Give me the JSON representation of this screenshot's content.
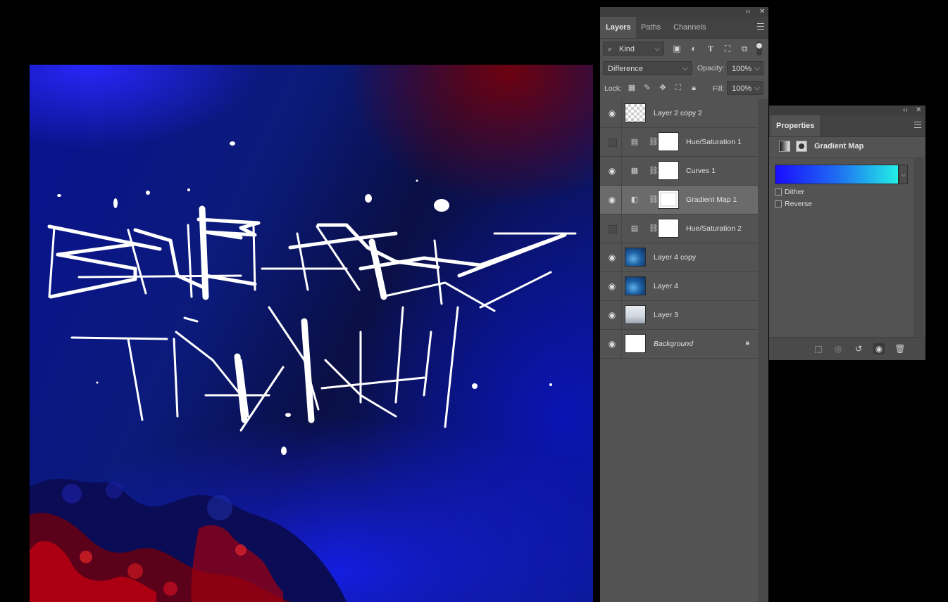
{
  "layers_panel": {
    "tabs": [
      "Layers",
      "Paths",
      "Channels"
    ],
    "filter_kind": "Kind",
    "blend_mode": "Difference",
    "opacity_label": "Opacity:",
    "opacity_value": "100%",
    "lock_label": "Lock:",
    "fill_label": "Fill:",
    "fill_value": "100%",
    "layers": [
      {
        "name": "Layer 2 copy 2",
        "visible": true,
        "thumb": "checker",
        "adjustment": null,
        "selected": false,
        "italic": false,
        "locked": false
      },
      {
        "name": "Hue/Saturation 1",
        "visible": false,
        "thumb": "mask",
        "adjustment": "hue-saturation-icon",
        "selected": false,
        "italic": false,
        "locked": false
      },
      {
        "name": "Curves 1",
        "visible": true,
        "thumb": "mask",
        "adjustment": "curves-icon",
        "selected": false,
        "italic": false,
        "locked": false
      },
      {
        "name": "Gradient Map 1",
        "visible": true,
        "thumb": "mask",
        "adjustment": "gradient-map-icon",
        "selected": true,
        "italic": false,
        "locked": false
      },
      {
        "name": "Hue/Saturation 2",
        "visible": false,
        "thumb": "mask",
        "adjustment": "hue-saturation-icon",
        "selected": false,
        "italic": false,
        "locked": false
      },
      {
        "name": "Layer 4 copy",
        "visible": true,
        "thumb": "water",
        "adjustment": null,
        "selected": false,
        "italic": false,
        "locked": false
      },
      {
        "name": "Layer 4",
        "visible": true,
        "thumb": "water",
        "adjustment": null,
        "selected": false,
        "italic": false,
        "locked": false
      },
      {
        "name": "Layer 3",
        "visible": true,
        "thumb": "snow",
        "adjustment": null,
        "selected": false,
        "italic": false,
        "locked": false
      },
      {
        "name": "Background",
        "visible": true,
        "thumb": "white",
        "adjustment": null,
        "selected": false,
        "italic": true,
        "locked": true
      }
    ]
  },
  "properties_panel": {
    "tab": "Properties",
    "title": "Gradient Map",
    "gradient_colors": [
      "#1a0cff",
      "#1f6cf2",
      "#22f0e6"
    ],
    "dither_label": "Dither",
    "reverse_label": "Reverse",
    "dither_checked": false,
    "reverse_checked": false
  },
  "colors": {
    "panel_bg": "#535353",
    "panel_header": "#424242",
    "selected_row": "#6b6b6b",
    "canvas_blue": "#0b1a86",
    "canvas_red": "#c00010"
  }
}
